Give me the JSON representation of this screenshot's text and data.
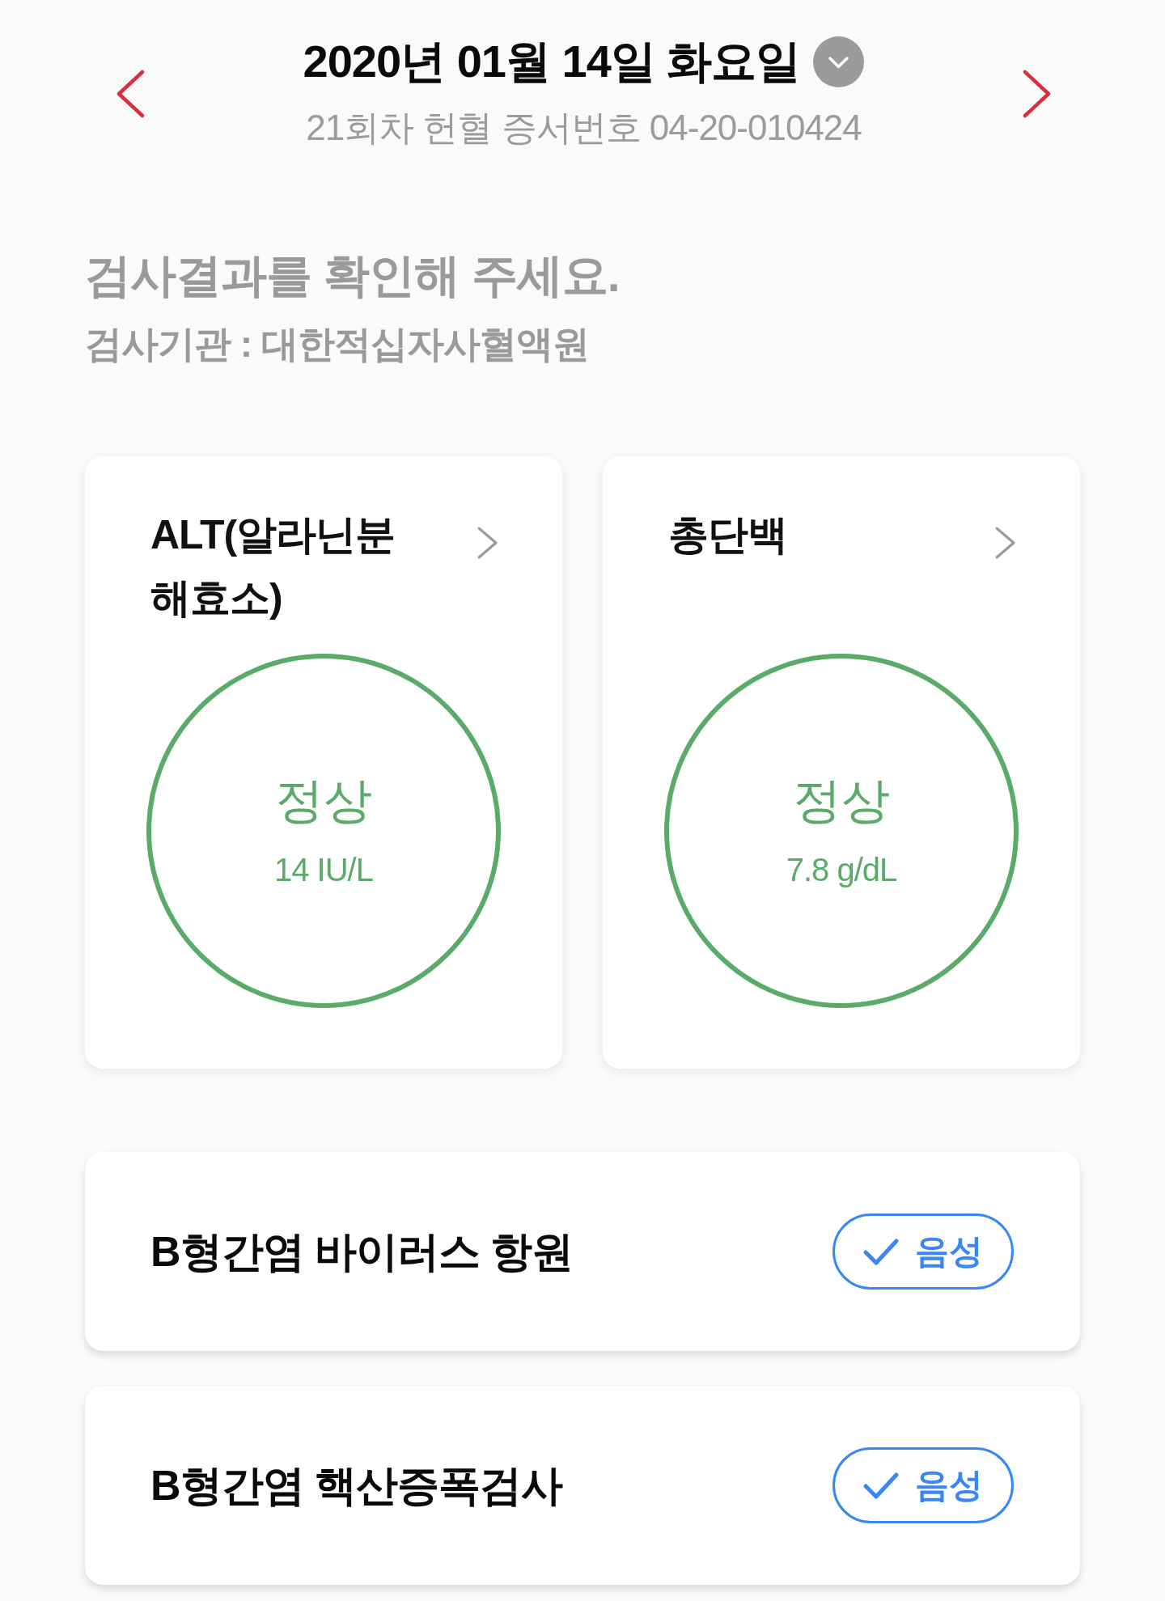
{
  "header": {
    "date": "2020년 01월 14일 화요일",
    "subtitle": "21회차 헌혈 증서번호 04-20-010424"
  },
  "intro": {
    "heading": "검사결과를 확인해 주세요.",
    "institution": "검사기관 : 대한적십자사혈액원"
  },
  "result_cards": [
    {
      "name": "ALT(알라닌분해효소)",
      "status": "정상",
      "value": "14 IU/L"
    },
    {
      "name": "총단백",
      "status": "정상",
      "value": "7.8 g/dL"
    }
  ],
  "result_rows": [
    {
      "name": "B형간염 바이러스 항원",
      "result": "음성"
    },
    {
      "name": "B형간염 핵산증폭검사",
      "result": "음성"
    }
  ]
}
